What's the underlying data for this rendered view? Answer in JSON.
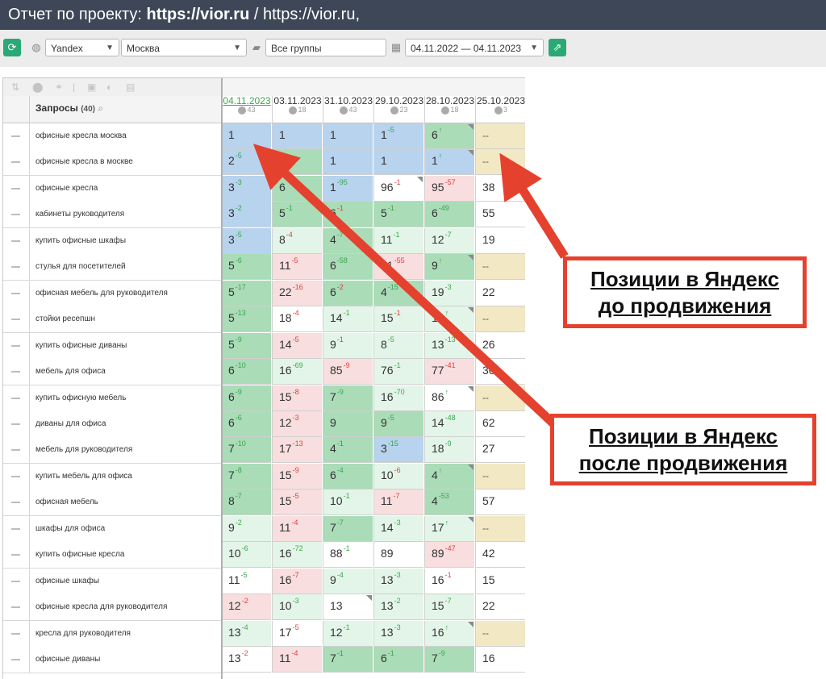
{
  "header": {
    "prefix": "Отчет по проекту: ",
    "project": "https://vior.ru",
    "suffix": " / https://vior.ru,"
  },
  "toolbar": {
    "engine": "Yandex",
    "region": "Москва",
    "group": "Все группы",
    "date_range": "04.11.2022 — 04.11.2023"
  },
  "table": {
    "query_header": "Запросы",
    "query_count": "(40)",
    "dates": [
      {
        "date": "04.11.2023",
        "count": "43"
      },
      {
        "date": "03.11.2023",
        "count": "18"
      },
      {
        "date": "31.10.2023",
        "count": "43"
      },
      {
        "date": "29.10.2023",
        "count": "23"
      },
      {
        "date": "28.10.2023",
        "count": "18"
      },
      {
        "date": "25.10.2023",
        "count": "3"
      }
    ],
    "rows": [
      {
        "query": "офисные кресла москва",
        "cells": [
          {
            "v": "1",
            "c": "blue"
          },
          {
            "v": "1",
            "c": "blue"
          },
          {
            "v": "1",
            "c": "blue"
          },
          {
            "v": "1",
            "d": "5",
            "dir": "up",
            "c": "blue"
          },
          {
            "v": "6",
            "d": "↑",
            "dir": "up",
            "c": "green",
            "tri": true
          },
          {
            "v": "--",
            "c": "tan",
            "dim": true
          }
        ]
      },
      {
        "query": "офисные кресла в москве",
        "cells": [
          {
            "v": "2",
            "d": "5",
            "dir": "up",
            "c": "blue"
          },
          {
            "v": "",
            "c": "green"
          },
          {
            "v": "1",
            "c": "blue"
          },
          {
            "v": "1",
            "c": "blue"
          },
          {
            "v": "1",
            "d": "↑",
            "dir": "up",
            "c": "blue",
            "tri": true
          },
          {
            "v": "--",
            "c": "tan",
            "dim": true
          }
        ]
      },
      {
        "query": "офисные кресла",
        "cells": [
          {
            "v": "3",
            "d": "3",
            "dir": "up",
            "c": "blue"
          },
          {
            "v": "6",
            "d": "",
            "dir": "up",
            "c": "green"
          },
          {
            "v": "1",
            "d": "95",
            "dir": "up",
            "c": "blue"
          },
          {
            "v": "96",
            "d": "1",
            "dir": "dn",
            "c": "white",
            "tri": true
          },
          {
            "v": "95",
            "d": "57",
            "dir": "dn",
            "c": "pink"
          },
          {
            "v": "38",
            "c": "white"
          }
        ]
      },
      {
        "query": "кабинеты руководителя",
        "cells": [
          {
            "v": "3",
            "d": "2",
            "dir": "up",
            "c": "blue"
          },
          {
            "v": "5",
            "d": "1",
            "dir": "up",
            "c": "green"
          },
          {
            "v": "6",
            "d": "1",
            "dir": "dn",
            "c": "green"
          },
          {
            "v": "5",
            "d": "1",
            "dir": "up",
            "c": "green"
          },
          {
            "v": "6",
            "d": "49",
            "dir": "up",
            "c": "green"
          },
          {
            "v": "55",
            "c": "white"
          }
        ]
      },
      {
        "query": "купить офисные шкафы",
        "cells": [
          {
            "v": "3",
            "d": "5",
            "dir": "up",
            "c": "blue"
          },
          {
            "v": "8",
            "d": "4",
            "dir": "dn",
            "c": "lgreen"
          },
          {
            "v": "4",
            "d": "7",
            "dir": "up",
            "c": "green"
          },
          {
            "v": "11",
            "d": "1",
            "dir": "up",
            "c": "lgreen"
          },
          {
            "v": "12",
            "d": "7",
            "dir": "up",
            "c": "lgreen"
          },
          {
            "v": "19",
            "c": "white"
          }
        ]
      },
      {
        "query": "стулья для посетителей",
        "cells": [
          {
            "v": "5",
            "d": "6",
            "dir": "up",
            "c": "green"
          },
          {
            "v": "11",
            "d": "5",
            "dir": "dn",
            "c": "pink"
          },
          {
            "v": "6",
            "d": "58",
            "dir": "up",
            "c": "green"
          },
          {
            "v": "61",
            "d": "55",
            "dir": "dn",
            "c": "pink"
          },
          {
            "v": "9",
            "d": "↑",
            "dir": "up",
            "c": "green",
            "tri": true
          },
          {
            "v": "--",
            "c": "tan",
            "dim": true
          }
        ]
      },
      {
        "query": "офисная мебель для руководителя",
        "cells": [
          {
            "v": "5",
            "d": "17",
            "dir": "up",
            "c": "green"
          },
          {
            "v": "22",
            "d": "16",
            "dir": "dn",
            "c": "pink"
          },
          {
            "v": "6",
            "d": "2",
            "dir": "dn",
            "c": "green"
          },
          {
            "v": "4",
            "d": "15",
            "dir": "up",
            "c": "green"
          },
          {
            "v": "19",
            "d": "3",
            "dir": "up",
            "c": "lgreen"
          },
          {
            "v": "22",
            "c": "white"
          }
        ]
      },
      {
        "query": "стойки ресепшн",
        "cells": [
          {
            "v": "5",
            "d": "13",
            "dir": "up",
            "c": "green"
          },
          {
            "v": "18",
            "d": "4",
            "dir": "dn",
            "c": "white"
          },
          {
            "v": "14",
            "d": "1",
            "dir": "up",
            "c": "lgreen"
          },
          {
            "v": "15",
            "d": "1",
            "dir": "dn",
            "c": "lgreen"
          },
          {
            "v": "14",
            "d": "↑",
            "dir": "up",
            "c": "lgreen",
            "tri": true
          },
          {
            "v": "--",
            "c": "tan",
            "dim": true
          }
        ]
      },
      {
        "query": "купить офисные диваны",
        "cells": [
          {
            "v": "5",
            "d": "9",
            "dir": "up",
            "c": "green"
          },
          {
            "v": "14",
            "d": "5",
            "dir": "dn",
            "c": "pink"
          },
          {
            "v": "9",
            "d": "1",
            "dir": "dn",
            "c": "lgreen"
          },
          {
            "v": "8",
            "d": "5",
            "dir": "up",
            "c": "lgreen"
          },
          {
            "v": "13",
            "d": "13",
            "dir": "up",
            "c": "lgreen"
          },
          {
            "v": "26",
            "c": "white"
          }
        ]
      },
      {
        "query": "мебель для офиса",
        "cells": [
          {
            "v": "6",
            "d": "10",
            "dir": "up",
            "c": "green"
          },
          {
            "v": "16",
            "d": "69",
            "dir": "up",
            "c": "lgreen"
          },
          {
            "v": "85",
            "d": "9",
            "dir": "dn",
            "c": "pink"
          },
          {
            "v": "76",
            "d": "1",
            "dir": "up",
            "c": "lgreen"
          },
          {
            "v": "77",
            "d": "41",
            "dir": "dn",
            "c": "pink"
          },
          {
            "v": "36",
            "c": "white"
          }
        ]
      },
      {
        "query": "купить офисную мебель",
        "cells": [
          {
            "v": "6",
            "d": "9",
            "dir": "up",
            "c": "green"
          },
          {
            "v": "15",
            "d": "8",
            "dir": "dn",
            "c": "pink"
          },
          {
            "v": "7",
            "d": "9",
            "dir": "up",
            "c": "green"
          },
          {
            "v": "16",
            "d": "70",
            "dir": "up",
            "c": "lgreen"
          },
          {
            "v": "86",
            "d": "↑",
            "dir": "up",
            "c": "white",
            "tri": true
          },
          {
            "v": "--",
            "c": "tan",
            "dim": true
          }
        ]
      },
      {
        "query": "диваны для офиса",
        "cells": [
          {
            "v": "6",
            "d": "6",
            "dir": "up",
            "c": "green"
          },
          {
            "v": "12",
            "d": "3",
            "dir": "dn",
            "c": "pink"
          },
          {
            "v": "9",
            "c": "green"
          },
          {
            "v": "9",
            "d": "5",
            "dir": "up",
            "c": "green"
          },
          {
            "v": "14",
            "d": "48",
            "dir": "up",
            "c": "lgreen"
          },
          {
            "v": "62",
            "c": "white"
          }
        ]
      },
      {
        "query": "мебель для руководителя",
        "cells": [
          {
            "v": "7",
            "d": "10",
            "dir": "up",
            "c": "green"
          },
          {
            "v": "17",
            "d": "13",
            "dir": "dn",
            "c": "pink"
          },
          {
            "v": "4",
            "d": "1",
            "dir": "dn",
            "c": "green"
          },
          {
            "v": "3",
            "d": "15",
            "dir": "up",
            "c": "blue"
          },
          {
            "v": "18",
            "d": "9",
            "dir": "up",
            "c": "lgreen"
          },
          {
            "v": "27",
            "c": "white"
          }
        ]
      },
      {
        "query": "купить мебель для офиса",
        "cells": [
          {
            "v": "7",
            "d": "8",
            "dir": "up",
            "c": "green"
          },
          {
            "v": "15",
            "d": "9",
            "dir": "dn",
            "c": "pink"
          },
          {
            "v": "6",
            "d": "4",
            "dir": "up",
            "c": "green"
          },
          {
            "v": "10",
            "d": "6",
            "dir": "dn",
            "c": "lgreen"
          },
          {
            "v": "4",
            "d": "↑",
            "dir": "up",
            "c": "green",
            "tri": true
          },
          {
            "v": "--",
            "c": "tan",
            "dim": true
          }
        ]
      },
      {
        "query": "офисная мебель",
        "cells": [
          {
            "v": "8",
            "d": "7",
            "dir": "up",
            "c": "green"
          },
          {
            "v": "15",
            "d": "5",
            "dir": "dn",
            "c": "pink"
          },
          {
            "v": "10",
            "d": "1",
            "dir": "up",
            "c": "lgreen"
          },
          {
            "v": "11",
            "d": "7",
            "dir": "dn",
            "c": "pink"
          },
          {
            "v": "4",
            "d": "53",
            "dir": "up",
            "c": "green"
          },
          {
            "v": "57",
            "c": "white"
          }
        ]
      },
      {
        "query": "шкафы для офиса",
        "cells": [
          {
            "v": "9",
            "d": "2",
            "dir": "up",
            "c": "lgreen"
          },
          {
            "v": "11",
            "d": "4",
            "dir": "dn",
            "c": "pink"
          },
          {
            "v": "7",
            "d": "7",
            "dir": "up",
            "c": "green"
          },
          {
            "v": "14",
            "d": "3",
            "dir": "up",
            "c": "lgreen"
          },
          {
            "v": "17",
            "d": "↑",
            "dir": "up",
            "c": "lgreen",
            "tri": true
          },
          {
            "v": "--",
            "c": "tan",
            "dim": true
          }
        ]
      },
      {
        "query": "купить офисные кресла",
        "cells": [
          {
            "v": "10",
            "d": "6",
            "dir": "up",
            "c": "lgreen"
          },
          {
            "v": "16",
            "d": "72",
            "dir": "up",
            "c": "lgreen"
          },
          {
            "v": "88",
            "d": "1",
            "dir": "up",
            "c": "white"
          },
          {
            "v": "89",
            "c": "white"
          },
          {
            "v": "89",
            "d": "47",
            "dir": "dn",
            "c": "pink"
          },
          {
            "v": "42",
            "c": "white"
          }
        ]
      },
      {
        "query": "офисные шкафы",
        "cells": [
          {
            "v": "11",
            "d": "5",
            "dir": "up",
            "c": "white"
          },
          {
            "v": "16",
            "d": "7",
            "dir": "dn",
            "c": "pink"
          },
          {
            "v": "9",
            "d": "4",
            "dir": "up",
            "c": "lgreen"
          },
          {
            "v": "13",
            "d": "3",
            "dir": "up",
            "c": "lgreen"
          },
          {
            "v": "16",
            "d": "1",
            "dir": "dn",
            "c": "white"
          },
          {
            "v": "15",
            "c": "white"
          }
        ]
      },
      {
        "query": "офисные кресла для руководителя",
        "cells": [
          {
            "v": "12",
            "d": "2",
            "dir": "dn",
            "c": "pink"
          },
          {
            "v": "10",
            "d": "3",
            "dir": "up",
            "c": "lgreen"
          },
          {
            "v": "13",
            "c": "white",
            "tri": true
          },
          {
            "v": "13",
            "d": "2",
            "dir": "up",
            "c": "lgreen"
          },
          {
            "v": "15",
            "d": "7",
            "dir": "up",
            "c": "lgreen"
          },
          {
            "v": "22",
            "c": "white"
          }
        ]
      },
      {
        "query": "кресла для руководителя",
        "cells": [
          {
            "v": "13",
            "d": "4",
            "dir": "up",
            "c": "lgreen"
          },
          {
            "v": "17",
            "d": "5",
            "dir": "dn",
            "c": "white"
          },
          {
            "v": "12",
            "d": "1",
            "dir": "up",
            "c": "lgreen"
          },
          {
            "v": "13",
            "d": "3",
            "dir": "up",
            "c": "lgreen"
          },
          {
            "v": "16",
            "d": "↑",
            "dir": "up",
            "c": "lgreen",
            "tri": true
          },
          {
            "v": "--",
            "c": "tan",
            "dim": true
          }
        ]
      },
      {
        "query": "офисные диваны",
        "cells": [
          {
            "v": "13",
            "d": "2",
            "dir": "dn",
            "c": "white"
          },
          {
            "v": "11",
            "d": "4",
            "dir": "dn",
            "c": "pink"
          },
          {
            "v": "7",
            "d": "1",
            "dir": "dn",
            "c": "green"
          },
          {
            "v": "6",
            "d": "1",
            "dir": "up",
            "c": "green"
          },
          {
            "v": "7",
            "d": "9",
            "dir": "up",
            "c": "green"
          },
          {
            "v": "16",
            "c": "white"
          }
        ]
      }
    ]
  },
  "annotations": {
    "before": [
      "Позиции в Яндекс",
      "до продвижения"
    ],
    "after": [
      "Позиции в Яндекс",
      "после продвижения"
    ]
  },
  "colors": {
    "header_bg": "#3d4757",
    "accent_green": "#2aa876",
    "cell_blue": "#b7d3ee",
    "cell_green": "#a9dcb7",
    "cell_light_green": "#e3f5e8",
    "cell_pink": "#f8dede",
    "cell_tan": "#f3e8c4",
    "arrow_red": "#e5412f"
  }
}
